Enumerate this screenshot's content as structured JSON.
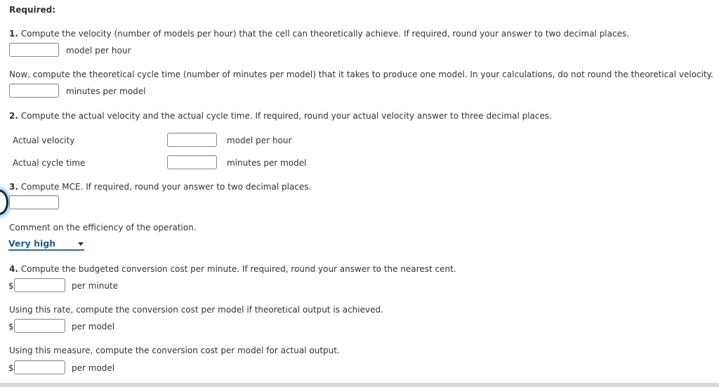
{
  "heading": "Required:",
  "q1": {
    "num": "1.",
    "text": " Compute the velocity (number of models per hour) that the cell can theoretically achieve. If required, round your answer to two decimal places.",
    "unit": "model per hour",
    "followup": "Now, compute the theoretical cycle time (number of minutes per model) that it takes to produce one model. In your calculations, do not round the theoretical velocity.",
    "followup_unit": "minutes per model"
  },
  "q2": {
    "num": "2.",
    "text": " Compute the actual velocity and the actual cycle time. If required, round your actual velocity answer to three decimal places.",
    "rows": [
      {
        "label": "Actual velocity",
        "unit": "model per hour"
      },
      {
        "label": "Actual cycle time",
        "unit": "minutes per model"
      }
    ]
  },
  "q3": {
    "num": "3.",
    "text": " Compute MCE. If required, round your answer to two decimal places.",
    "comment": "Comment on the efficiency of the operation.",
    "select_value": "Very high"
  },
  "q4": {
    "num": "4.",
    "text": " Compute the budgeted conversion cost per minute. If required, round your answer to the nearest cent.",
    "currency": "$",
    "unit1": "per minute",
    "p2": "Using this rate, compute the conversion cost per model if theoretical output is achieved.",
    "unit2": "per model",
    "p3": "Using this measure, compute the conversion cost per model for actual output.",
    "unit3": "per model"
  }
}
